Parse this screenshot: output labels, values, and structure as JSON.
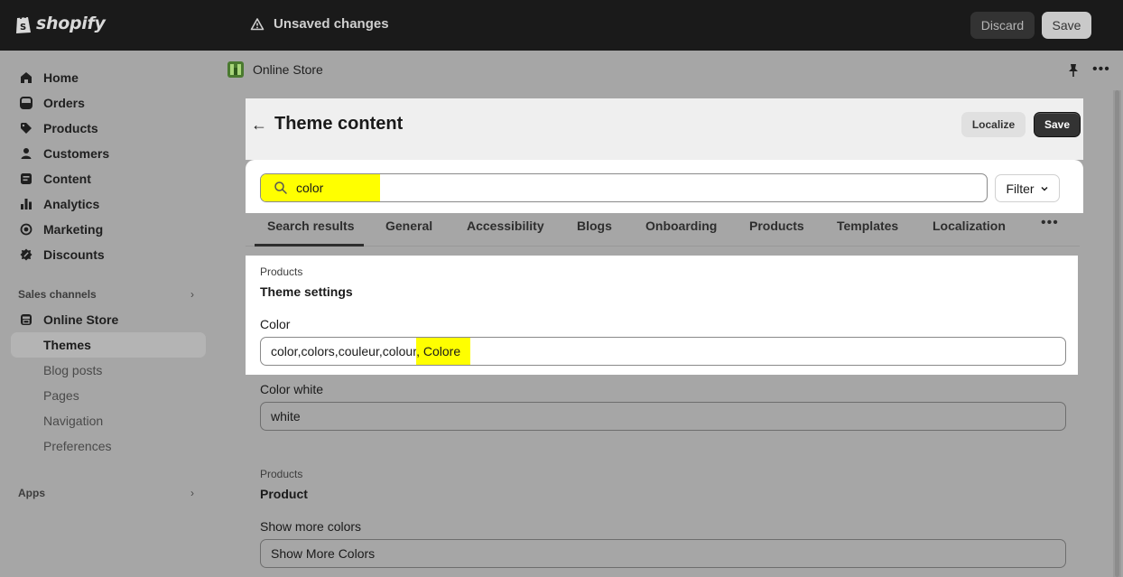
{
  "topbar": {
    "brand": "shopify",
    "status": "Unsaved changes",
    "discard_label": "Discard",
    "save_label": "Save"
  },
  "sidebar": {
    "items": [
      {
        "label": "Home",
        "icon": "home-icon"
      },
      {
        "label": "Orders",
        "icon": "orders-icon"
      },
      {
        "label": "Products",
        "icon": "tag-icon"
      },
      {
        "label": "Customers",
        "icon": "person-icon"
      },
      {
        "label": "Content",
        "icon": "content-icon"
      },
      {
        "label": "Analytics",
        "icon": "bar-chart-icon"
      },
      {
        "label": "Marketing",
        "icon": "target-icon"
      },
      {
        "label": "Discounts",
        "icon": "discount-icon"
      }
    ],
    "sales_channels_label": "Sales channels",
    "online_store_label": "Online Store",
    "sub_items": [
      "Themes",
      "Blog posts",
      "Pages",
      "Navigation",
      "Preferences"
    ],
    "apps_label": "Apps"
  },
  "breadcrumb": {
    "label": "Online Store"
  },
  "header": {
    "title": "Theme content",
    "localize_label": "Localize",
    "save_label": "Save"
  },
  "search": {
    "value": "color",
    "filter_label": "Filter"
  },
  "tabs": [
    "Search results",
    "General",
    "Accessibility",
    "Blogs",
    "Onboarding",
    "Products",
    "Templates",
    "Localization"
  ],
  "results": {
    "group1": {
      "category": "Products",
      "title": "Theme settings",
      "field1_label": "Color",
      "field1_value_plain": "color,colors,couleur,colour",
      "field1_value_highlight": ", Colore",
      "field2_label": "Color white",
      "field2_value": "white"
    },
    "group2": {
      "category": "Products",
      "title": "Product",
      "field1_label": "Show more colors",
      "field1_value": "Show More Colors"
    }
  },
  "colors": {
    "highlight": "#ffff00",
    "topbar": "#1a1a1a",
    "overlay": "#a6a6a6"
  }
}
